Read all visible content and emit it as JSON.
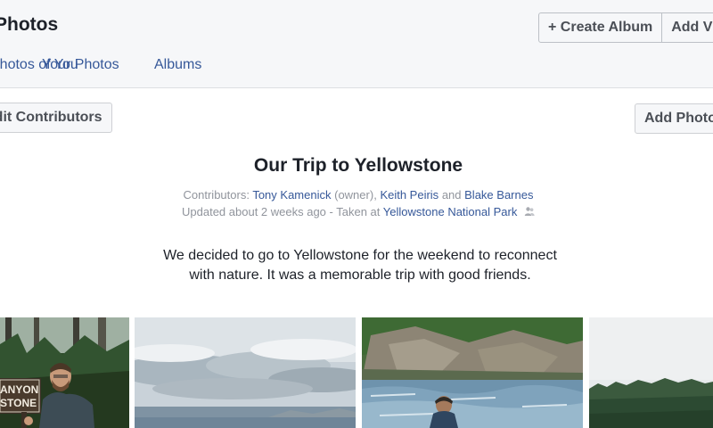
{
  "header": {
    "title": "Photos",
    "actions": {
      "create_album": "+ Create Album",
      "add_videos": "Add Videos"
    },
    "tabs": [
      {
        "label": "Photos of You"
      },
      {
        "label": "Your Photos"
      },
      {
        "label": "Albums"
      }
    ]
  },
  "toolbar": {
    "contributors_button": "Edit Contributors",
    "add_photos_button": "Add Photos"
  },
  "album": {
    "title": "Our Trip to Yellowstone",
    "contributors_label": "Contributors:",
    "contributors": [
      {
        "name": "Tony Kamenick",
        "note": "(owner)"
      },
      {
        "name": "Keith Peiris"
      },
      {
        "name": "Blake Barnes"
      }
    ],
    "joiner_comma": ",",
    "joiner_and": "and",
    "updated": "Updated about 2 weeks ago",
    "taken_at_label": "- Taken at",
    "location": "Yellowstone National Park",
    "description_line1": "We decided to go to Yellowstone for the weekend to reconnect",
    "description_line2": "with nature. It was a memorable trip with good friends.",
    "photos": [
      {
        "sign_text_1": "ANYON",
        "sign_text_2": "STONE"
      },
      {},
      {},
      {}
    ]
  },
  "colors": {
    "link": "#365899",
    "header_bg": "#f6f7f9",
    "meta_text": "#90949c"
  },
  "icons": {
    "tagged_people": "people-tag-icon"
  }
}
